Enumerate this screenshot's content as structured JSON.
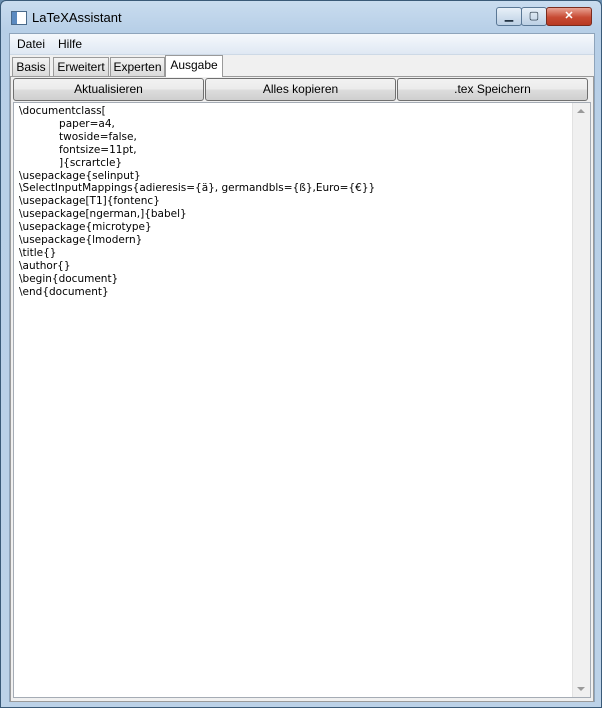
{
  "window": {
    "title": "LaTeXAssistant"
  },
  "window_controls": {
    "minimize": "▁",
    "maximize": "▢",
    "close": "✕"
  },
  "menu": {
    "items": [
      {
        "label": "Datei"
      },
      {
        "label": "Hilfe"
      }
    ]
  },
  "tabs": [
    {
      "label": "Basis",
      "active": false
    },
    {
      "label": "Erweitert",
      "active": false
    },
    {
      "label": "Experten",
      "active": false
    },
    {
      "label": "Ausgabe",
      "active": true
    }
  ],
  "toolbar": {
    "refresh_label": "Aktualisieren",
    "copy_all_label": "Alles kopieren",
    "save_tex_label": ".tex Speichern"
  },
  "editor": {
    "content": "\\documentclass[\n            paper=a4,\n            twoside=false,\n            fontsize=11pt,\n            ]{scrartcle}\n\\usepackage{selinput}\n\\SelectInputMappings{adieresis={ä}, germandbls={ß},Euro={€}}\n\\usepackage[T1]{fontenc}\n\\usepackage[ngerman,]{babel}\n\\usepackage{microtype}\n\\usepackage{lmodern}\n\\title{}\n\\author{}\n\\begin{document}\n\\end{document}"
  }
}
